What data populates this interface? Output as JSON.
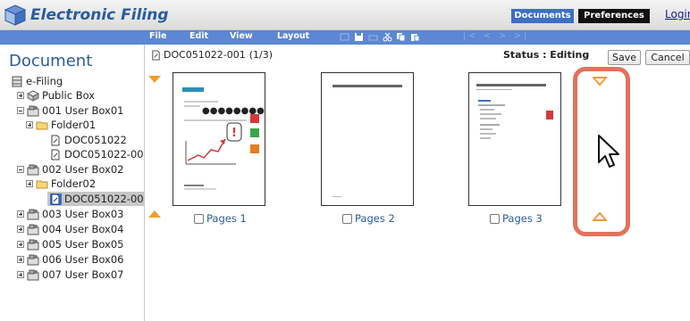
{
  "app": {
    "title": "Electronic Filing"
  },
  "nav": {
    "documents": "Documents",
    "preferences": "Preferences",
    "login": "Login"
  },
  "menu": {
    "file": "File",
    "edit": "Edit",
    "view": "View",
    "layout": "Layout",
    "pager": "|< < > >|"
  },
  "sidebar": {
    "heading": "Document",
    "root": "e-Filing",
    "public_box": "Public Box",
    "box1": "001 User Box01",
    "folder01": "Folder01",
    "doc_a": "DOC051022",
    "doc_b": "DOC051022-00",
    "box2": "002 User Box02",
    "folder02": "Folder02",
    "doc_c": "DOC051022-00",
    "box3": "003 User Box03",
    "box4": "004 User Box04",
    "box5": "005 User Box05",
    "box6": "006 User Box06",
    "box7": "007 User Box07"
  },
  "document": {
    "path": "DOC051022-001",
    "page_info": "(1/3)",
    "status": "Status : Editing"
  },
  "buttons": {
    "save": "Save",
    "cancel": "Cancel"
  },
  "pages": [
    {
      "label": "Pages 1"
    },
    {
      "label": "Pages 2"
    },
    {
      "label": "Pages 3"
    }
  ],
  "colors": {
    "accent": "#3d6fc5",
    "menubar": "#5b87d4",
    "arrow": "#f39c32",
    "highlight": "#e2725b"
  }
}
